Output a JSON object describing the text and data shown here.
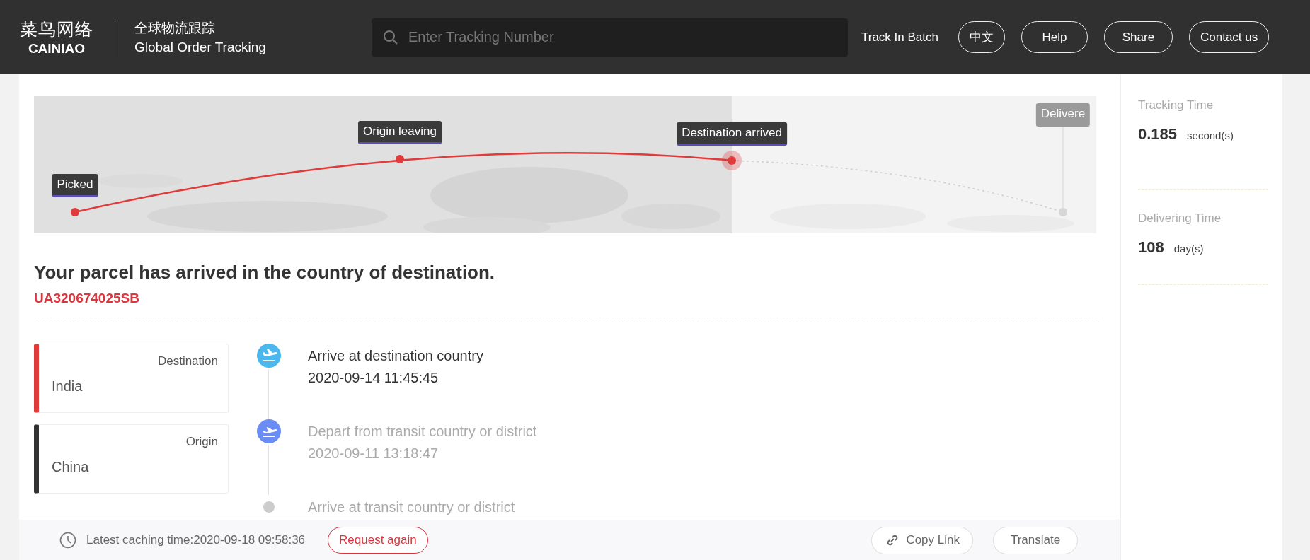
{
  "header": {
    "logo": {
      "cn": "菜鸟网络",
      "en": "CAINIAO"
    },
    "subtitle": {
      "cn": "全球物流跟踪",
      "en": "Global Order Tracking"
    },
    "search": {
      "placeholder": "Enter Tracking Number"
    },
    "batch_link": "Track In Batch",
    "buttons": [
      "中文",
      "Help",
      "Share",
      "Contact us"
    ]
  },
  "map": {
    "nodes": [
      {
        "label": "Picked",
        "reached": true
      },
      {
        "label": "Origin leaving",
        "reached": true
      },
      {
        "label": "Destination arrived",
        "reached": true
      },
      {
        "label": "Delivere",
        "reached": false
      }
    ]
  },
  "status": {
    "title": "Your parcel has arrived in the country of destination.",
    "tracking_number": "UA320674025SB"
  },
  "route_cards": [
    {
      "label": "Destination",
      "value": "India",
      "color": "#e03a3a"
    },
    {
      "label": "Origin",
      "value": "China",
      "color": "#333333"
    }
  ],
  "timeline": [
    {
      "kind": "arrive",
      "title": "Arrive at destination country",
      "time": "2020-09-14 11:45:45",
      "current": true
    },
    {
      "kind": "depart",
      "title": "Depart from transit country or district",
      "time": "2020-09-11 13:18:47",
      "current": false
    },
    {
      "kind": "dot",
      "title": "Arrive at transit country or district",
      "current": false
    }
  ],
  "footer": {
    "cache_time": "Latest caching time:2020-09-18 09:58:36",
    "request_button": "Request again",
    "copy_link": "Copy Link",
    "translate": "Translate"
  },
  "sidebar": {
    "stats": [
      {
        "label": "Tracking Time",
        "value": "0.185",
        "unit": "second(s)"
      },
      {
        "label": "Delivering Time",
        "value": "108",
        "unit": "day(s)"
      }
    ]
  }
}
